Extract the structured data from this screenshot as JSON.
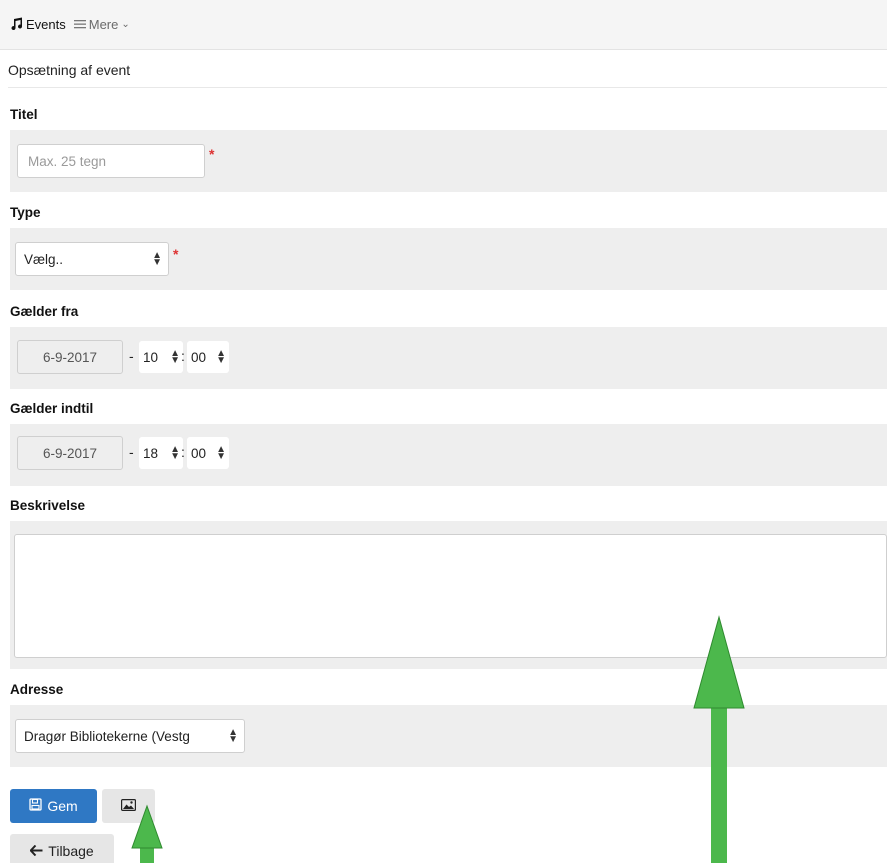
{
  "nav": {
    "events_label": "Events",
    "more_label": "Mere"
  },
  "page": {
    "title": "Opsætning af event"
  },
  "fields": {
    "title": {
      "label": "Titel",
      "placeholder": "Max. 25 tegn",
      "required_mark": "*"
    },
    "type": {
      "label": "Type",
      "selected": "Vælg..",
      "required_mark": "*"
    },
    "valid_from": {
      "label": "Gælder fra",
      "date": "6-9-2017",
      "separator": "-",
      "hour": "10",
      "time_separator": ":",
      "minute": "00"
    },
    "valid_until": {
      "label": "Gælder indtil",
      "date": "6-9-2017",
      "separator": "-",
      "hour": "18",
      "time_separator": ":",
      "minute": "00"
    },
    "description": {
      "label": "Beskrivelse",
      "value": ""
    },
    "address": {
      "label": "Adresse",
      "selected": "Dragør Bibliotekerne (Vestg"
    }
  },
  "actions": {
    "save_label": "Gem",
    "back_label": "Tilbage"
  },
  "icons": {
    "events": "music-note-icon",
    "more": "hamburger-menu-icon",
    "save": "floppy-disk-icon",
    "image": "image-icon",
    "back": "arrow-left-icon"
  },
  "colors": {
    "primary_button": "#2f78c4",
    "required": "#dd3333",
    "annotation_arrow": "#4cb84c"
  }
}
